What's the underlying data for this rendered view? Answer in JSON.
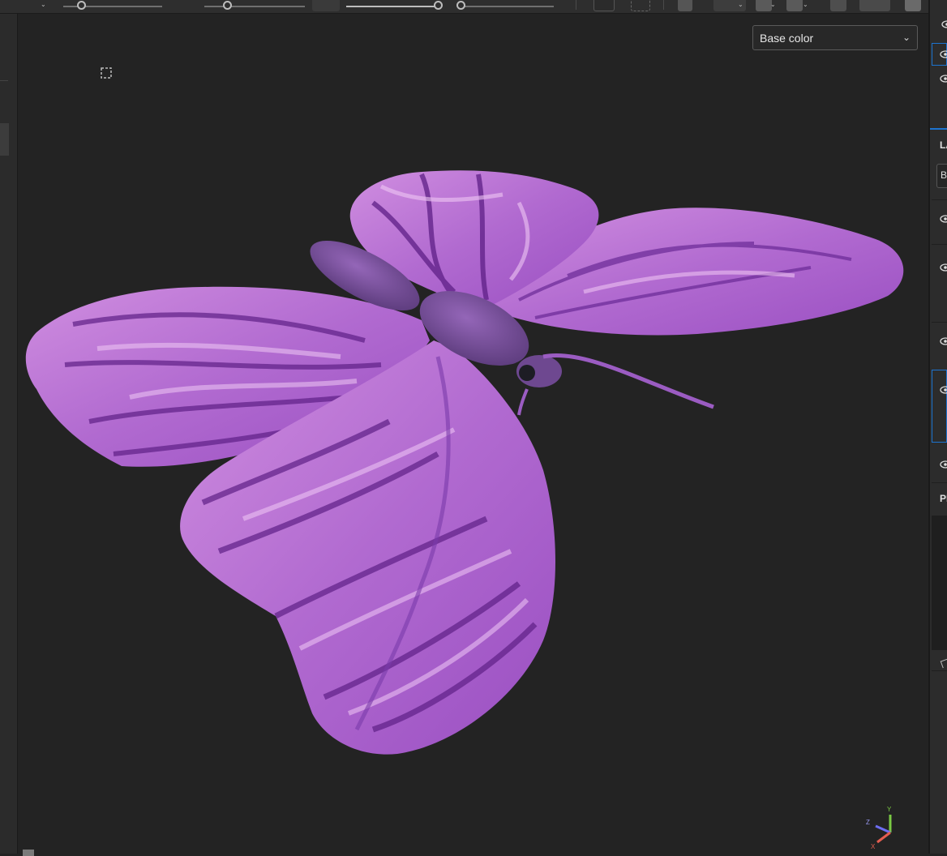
{
  "viewport": {
    "channel_select": {
      "value": "Base color"
    }
  },
  "right_panel": {
    "section_layers_label": "LA",
    "blend_field_label": "B",
    "section_properties_label": "PI"
  },
  "gizmo": {
    "z": "Z",
    "y": "Y",
    "x": "X"
  },
  "colors": {
    "wing_base": "#b975d4",
    "wing_dark": "#5e1f86",
    "wing_highlight": "#e9b6ef",
    "accent_blue": "#1d74d0",
    "background": "#232323"
  }
}
